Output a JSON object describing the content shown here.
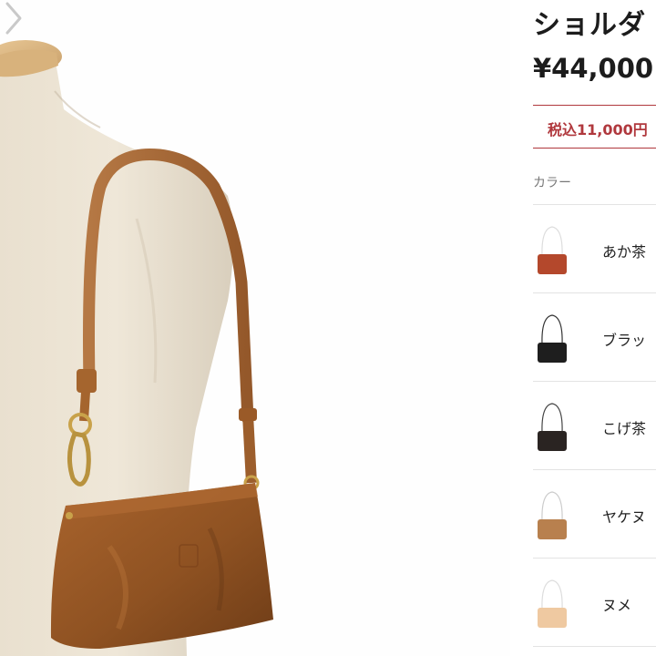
{
  "product": {
    "title": "ショルダ",
    "price": "¥44,000",
    "tax_note": "税込11,000円",
    "color_label": "カラー"
  },
  "colors": [
    {
      "name": "あか茶",
      "hex": "#b4482c"
    },
    {
      "name": "ブラッ",
      "hex": "#1e1e1e"
    },
    {
      "name": "こげ茶",
      "hex": "#2a2422"
    },
    {
      "name": "ヤケヌ",
      "hex": "#b8804e"
    },
    {
      "name": "ヌメ",
      "hex": "#efc9a1"
    }
  ],
  "gallery": {
    "icons": [
      "mannequin",
      "shoulder-bag",
      "chevron-right-icon"
    ],
    "bag_color": "#9c5a27"
  }
}
